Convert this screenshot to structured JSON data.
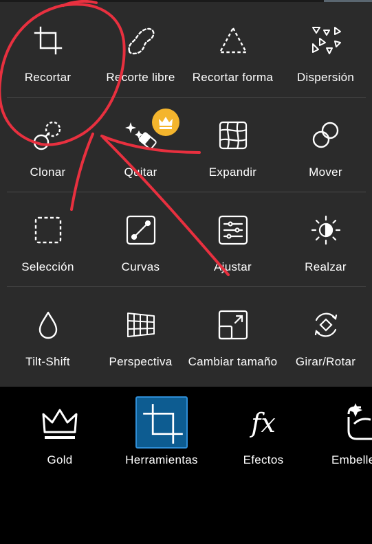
{
  "tools": [
    {
      "label": "Recortar",
      "icon": "crop-icon"
    },
    {
      "label": "Recorte libre",
      "icon": "freehand-crop-icon"
    },
    {
      "label": "Recortar forma",
      "icon": "shape-crop-icon"
    },
    {
      "label": "Dispersión",
      "icon": "dispersion-icon"
    },
    {
      "label": "Clonar",
      "icon": "clone-icon"
    },
    {
      "label": "Quitar",
      "icon": "remove-icon",
      "premium": true
    },
    {
      "label": "Expandir",
      "icon": "expand-icon"
    },
    {
      "label": "Mover",
      "icon": "move-icon"
    },
    {
      "label": "Selección",
      "icon": "selection-icon"
    },
    {
      "label": "Curvas",
      "icon": "curves-icon"
    },
    {
      "label": "Ajustar",
      "icon": "adjust-icon"
    },
    {
      "label": "Realzar",
      "icon": "enhance-icon"
    },
    {
      "label": "Tilt-Shift",
      "icon": "tilt-shift-icon"
    },
    {
      "label": "Perspectiva",
      "icon": "perspective-icon"
    },
    {
      "label": "Cambiar tamaño",
      "icon": "resize-icon"
    },
    {
      "label": "Girar/Rotar",
      "icon": "rotate-icon"
    }
  ],
  "nav": [
    {
      "label": "Gold",
      "icon": "gold-crown-icon"
    },
    {
      "label": "Herramientas",
      "icon": "tools-crop-icon",
      "active": true
    },
    {
      "label": "Efectos",
      "icon": "fx-icon"
    },
    {
      "label": "Embellecer",
      "icon": "beautify-icon"
    }
  ],
  "colors": {
    "panel": "#2b2b2b",
    "divider": "#4a4a4a",
    "premium_badge": "#f4b52d",
    "active_tab": "#0d5c91",
    "annotation": "#e8303f"
  }
}
